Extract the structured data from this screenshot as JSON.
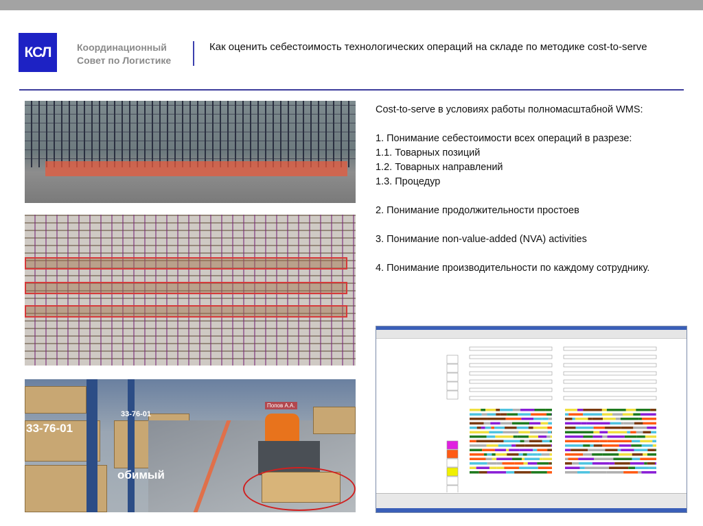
{
  "header": {
    "logo_text": "КСЛ",
    "org_line1": "Координационный",
    "org_line2": "Совет по Логистике",
    "title": "Как оценить себестоимость технологических операций на складе по методике cost-to-serve"
  },
  "images": {
    "img3_labels": [
      "33-76-01",
      "33-76-01",
      "обимый",
      "Попов А.А."
    ]
  },
  "body": {
    "lines": [
      "Cost-to-serve в условиях работы полномасштабной WMS:",
      "",
      "1.  Понимание себестоимости всех операций в разрезе:",
      "1.1. Товарных позиций",
      "1.2. Товарных направлений",
      "1.3. Процедур",
      "",
      "2. Понимание продолжительности простоев",
      "",
      "3. Понимание non-value-added (NVA) activities",
      "",
      "4. Понимание производительности по каждому сотруднику."
    ]
  },
  "colors": {
    "brand": "#1d22c4",
    "accent_line": "#3b3b9c",
    "wms_palette": [
      "#8a1fd6",
      "#1f7a1f",
      "#4fc3e0",
      "#f0e040",
      "#ff5a14",
      "#b0b0b0",
      "#7a3a10"
    ]
  }
}
